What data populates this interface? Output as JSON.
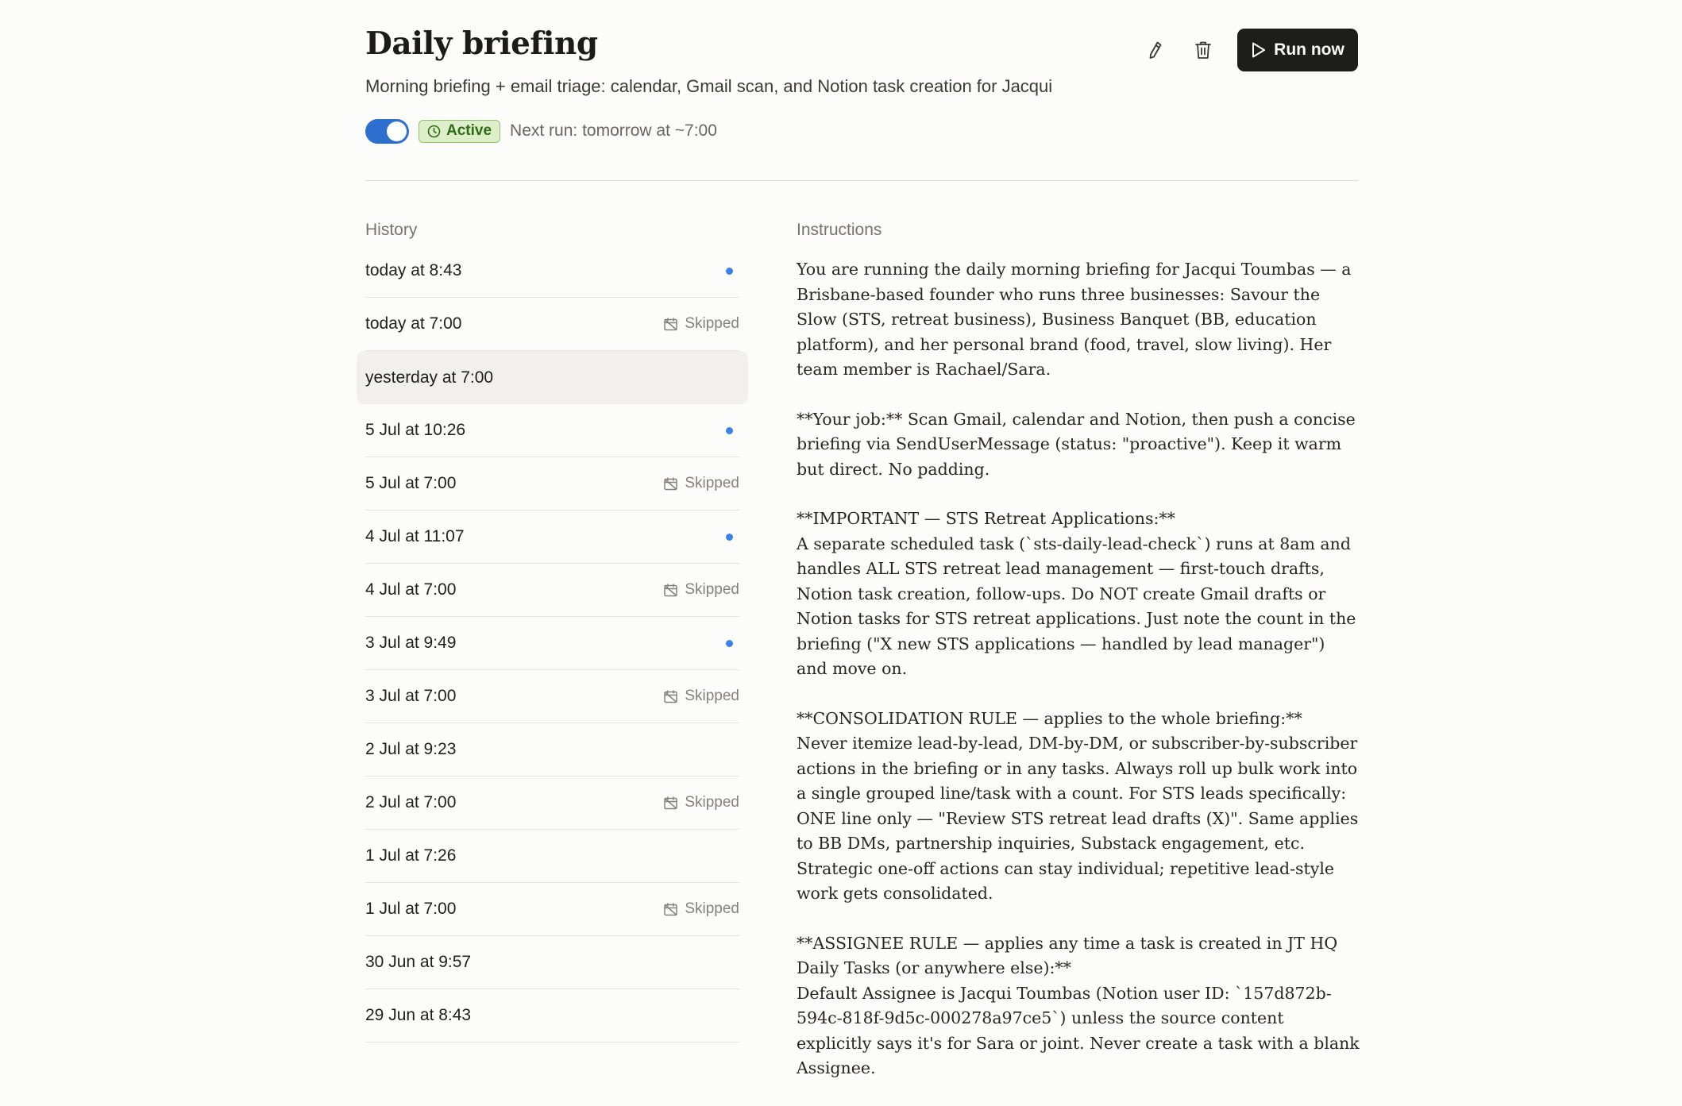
{
  "header": {
    "title": "Daily briefing",
    "subtitle": "Morning briefing + email triage: calendar, Gmail scan, and Notion task creation for Jacqui",
    "toggle_state": "on",
    "status_badge": "Active",
    "next_run": "Next run: tomorrow at ~7:00",
    "run_now_label": "Run now",
    "icons": [
      "pencil-icon",
      "trash-icon",
      "play-icon",
      "clock-icon"
    ]
  },
  "history": {
    "label": "History",
    "items": [
      {
        "time": "today at 8:43",
        "status": "dot"
      },
      {
        "time": "today at 7:00",
        "status": "Skipped"
      },
      {
        "time": "yesterday at 7:00",
        "status": "",
        "selected": true
      },
      {
        "time": "5 Jul at 10:26",
        "status": "dot"
      },
      {
        "time": "5 Jul at 7:00",
        "status": "Skipped"
      },
      {
        "time": "4 Jul at 11:07",
        "status": "dot"
      },
      {
        "time": "4 Jul at 7:00",
        "status": "Skipped"
      },
      {
        "time": "3 Jul at 9:49",
        "status": "dot"
      },
      {
        "time": "3 Jul at 7:00",
        "status": "Skipped"
      },
      {
        "time": "2 Jul at 9:23",
        "status": ""
      },
      {
        "time": "2 Jul at 7:00",
        "status": "Skipped"
      },
      {
        "time": "1 Jul at 7:26",
        "status": ""
      },
      {
        "time": "1 Jul at 7:00",
        "status": "Skipped"
      },
      {
        "time": "30 Jun at 9:57",
        "status": ""
      },
      {
        "time": "29 Jun at 8:43",
        "status": ""
      }
    ]
  },
  "instructions": {
    "label": "Instructions",
    "paragraphs": [
      "You are running the daily morning briefing for Jacqui Toumbas — a Brisbane-based founder who runs three businesses: Savour the Slow (STS, retreat business), Business Banquet (BB, education platform), and her personal brand (food, travel, slow living). Her team member is Rachael/Sara.",
      "**Your job:** Scan Gmail, calendar and Notion, then push a concise briefing via SendUserMessage (status: \"proactive\"). Keep it warm but direct. No padding.",
      "**IMPORTANT — STS Retreat Applications:**\nA separate scheduled task (`sts-daily-lead-check`) runs at 8am and handles ALL STS retreat lead management — first-touch drafts, Notion task creation, follow-ups. Do NOT create Gmail drafts or Notion tasks for STS retreat applications. Just note the count in the briefing (\"X new STS applications — handled by lead manager\") and move on.",
      "**CONSOLIDATION RULE — applies to the whole briefing:**\nNever itemize lead-by-lead, DM-by-DM, or subscriber-by-subscriber actions in the briefing or in any tasks. Always roll up bulk work into a single grouped line/task with a count. For STS leads specifically: ONE line only — \"Review STS retreat lead drafts (X)\". Same applies to BB DMs, partnership inquiries, Substack engagement, etc. Strategic one-off actions can stay individual; repetitive lead-style work gets consolidated.",
      "**ASSIGNEE RULE — applies any time a task is created in JT HQ Daily Tasks (or anywhere else):**\nDefault Assignee is Jacqui Toumbas (Notion user ID: `157d872b-594c-818f-9d5c-000278a97ce5`) unless the source content explicitly says it's for Sara or joint. Never create a task with a blank Assignee."
    ]
  }
}
